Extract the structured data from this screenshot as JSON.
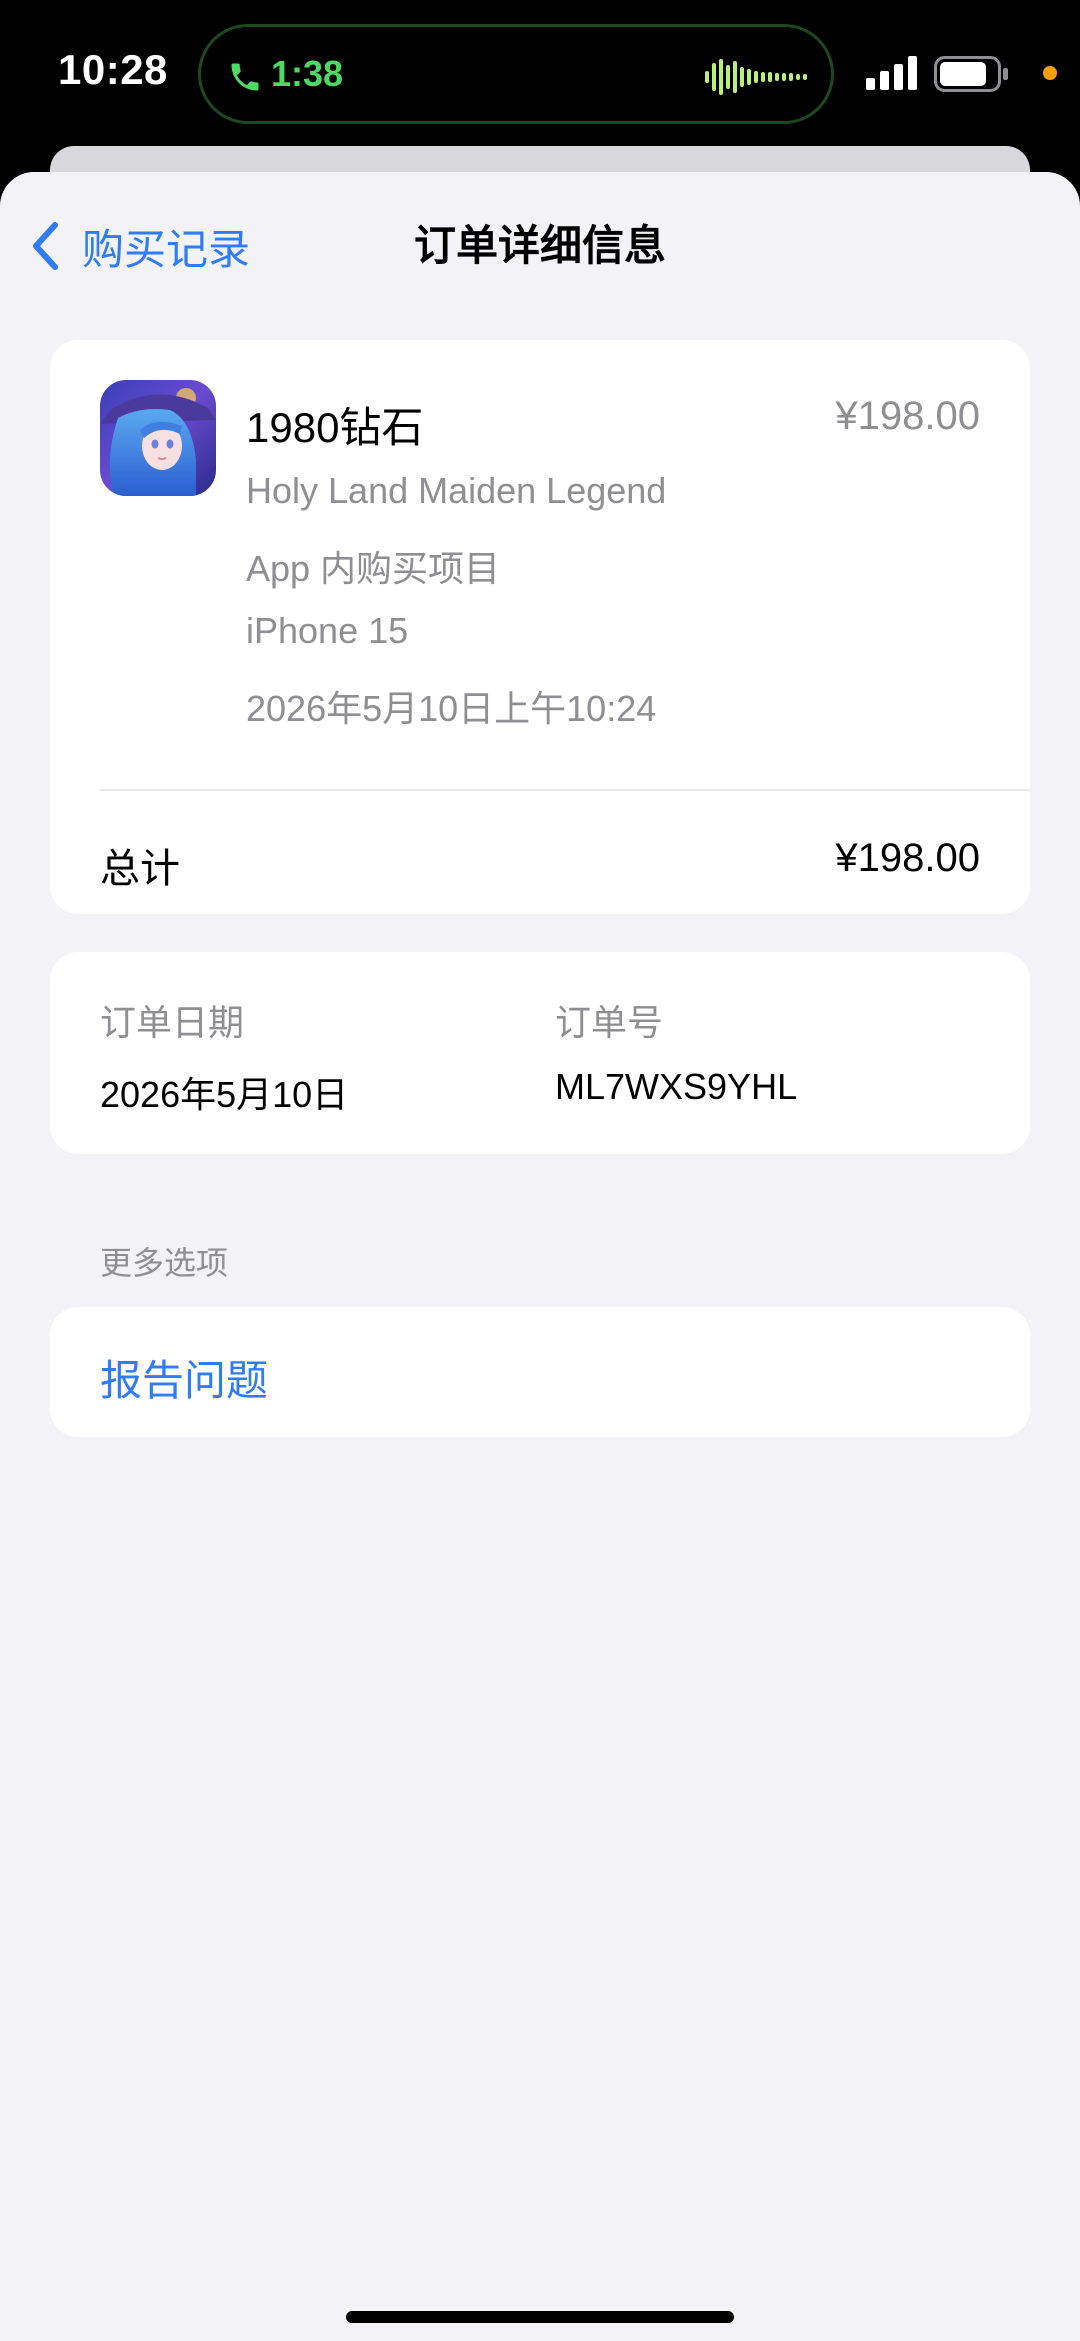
{
  "status": {
    "time": "10:28",
    "call_duration": "1:38"
  },
  "nav": {
    "back_label": "购买记录",
    "title": "订单详细信息"
  },
  "item": {
    "name": "1980钻石",
    "price": "¥198.00",
    "app_name": "Holy Land Maiden Legend",
    "type": "App 内购买项目",
    "device": "iPhone 15",
    "datetime": "2026年5月10日上午10:24"
  },
  "total": {
    "label": "总计",
    "value": "¥198.00"
  },
  "order": {
    "date_label": "订单日期",
    "date_value": "2026年5月10日",
    "number_label": "订单号",
    "number_value": "ML7WXS9YHL"
  },
  "more": {
    "section_label": "更多选项",
    "report_label": "报告问题"
  },
  "colors": {
    "accent": "#2f7cf6",
    "call_green": "#4cd964",
    "secondary_text": "#8e8e93",
    "background": "#f2f2f7"
  },
  "icons": {
    "back": "chevron-left-icon",
    "call": "phone-icon",
    "signal": "cellular-signal-icon",
    "battery": "battery-icon"
  }
}
